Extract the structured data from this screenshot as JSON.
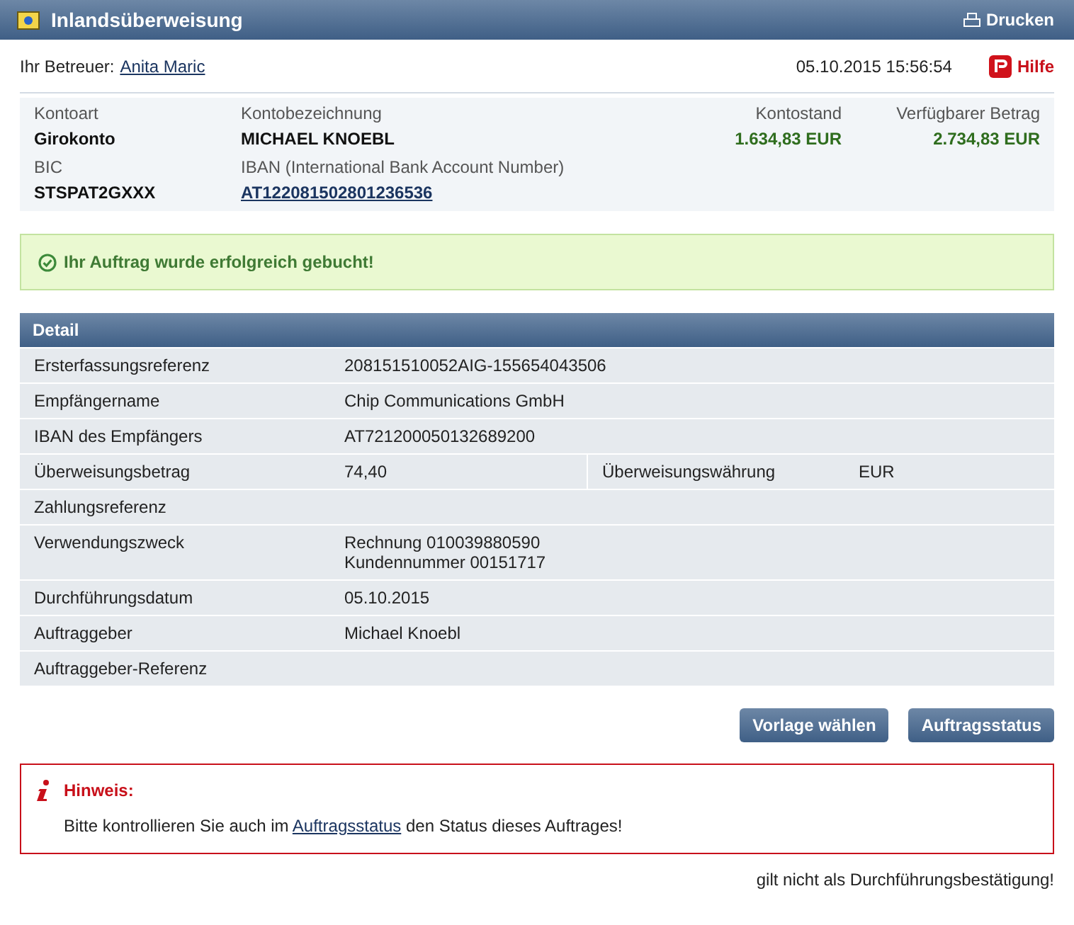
{
  "window": {
    "title": "Inlandsüberweisung",
    "print_label": "Drucken"
  },
  "advisor": {
    "label": "Ihr Betreuer:",
    "name": "Anita Maric"
  },
  "datetime": "05.10.2015 15:56:54",
  "help_label": "Hilfe",
  "account": {
    "fields": [
      {
        "label": "Kontoart",
        "value": "Girokonto",
        "kind": "text"
      },
      {
        "label": "Kontobezeichnung",
        "value": "MICHAEL KNOEBL",
        "kind": "text"
      },
      {
        "label": "Kontostand",
        "value": "1.634,83 EUR",
        "kind": "amount"
      },
      {
        "label": "Verfügbarer Betrag",
        "value": "2.734,83 EUR",
        "kind": "amount"
      },
      {
        "label": "BIC",
        "value": "STSPAT2GXXX",
        "kind": "text"
      },
      {
        "label": "IBAN (International Bank Account Number)",
        "value": "AT122081502801236536",
        "kind": "link"
      }
    ]
  },
  "success_message": "Ihr Auftrag wurde erfolgreich gebucht!",
  "detail": {
    "title": "Detail",
    "rows": [
      {
        "kind": "single",
        "label": "Ersterfassungsreferenz",
        "value": "208151510052AIG-155654043506"
      },
      {
        "kind": "single",
        "label": "Empfängername",
        "value": "Chip Communications GmbH"
      },
      {
        "kind": "single",
        "label": "IBAN des Empfängers",
        "value": "AT721200050132689200"
      },
      {
        "kind": "split",
        "label": "Überweisungsbetrag",
        "value": "74,40",
        "label_2": "Überweisungswährung",
        "value_2": "EUR"
      },
      {
        "kind": "single",
        "label": "Zahlungsreferenz"
      },
      {
        "kind": "single",
        "label": "Verwendungszweck",
        "value": "Rechnung 010039880590\nKundennummer 00151717"
      },
      {
        "kind": "single",
        "label": "Durchführungsdatum",
        "value": "05.10.2015"
      },
      {
        "kind": "single",
        "label": "Auftraggeber",
        "value": "Michael Knoebl"
      },
      {
        "kind": "single",
        "label": "Auftraggeber-Referenz"
      }
    ]
  },
  "buttons": [
    "Vorlage wählen",
    "Auftragsstatus"
  ],
  "notice": {
    "title": "Hinweis:",
    "text_before": "Bitte kontrollieren Sie auch im",
    "link": "Auftragsstatus",
    "text_after": "den Status dieses Auftrages!"
  },
  "footer_note": "gilt nicht als Durchführungsbestätigung!"
}
